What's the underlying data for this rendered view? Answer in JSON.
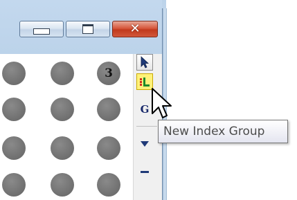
{
  "window": {
    "caption_buttons": {
      "minimize_icon": "minimize-glyph",
      "maximize_icon": "restore-glyph",
      "close_icon": "close-x-glyph",
      "close_glyph": "✕"
    },
    "colors": {
      "frame": "#bcd3ea",
      "close_button": "#c9432a",
      "dot_fill": "#6f6f6f",
      "tooltip_border": "#767676",
      "index_tool_background": "#fff27a"
    }
  },
  "grid": {
    "dots": [
      {
        "label": ""
      },
      {
        "label": ""
      },
      {
        "label": "3"
      },
      {
        "label": ""
      },
      {
        "label": ""
      },
      {
        "label": ""
      },
      {
        "label": ""
      },
      {
        "label": ""
      },
      {
        "label": ""
      },
      {
        "label": ""
      },
      {
        "label": ""
      },
      {
        "label": ""
      }
    ]
  },
  "toolbar": {
    "items": [
      {
        "icon": "select-pointer-icon"
      },
      {
        "icon": "new-index-group-icon"
      },
      {
        "icon": "g-letter-icon",
        "text": "G"
      },
      {
        "icon": "triangle-down-icon"
      },
      {
        "icon": "dash-icon"
      }
    ]
  },
  "tooltip": {
    "text": "New Index Group"
  },
  "cursor": {
    "icon": "arrow-cursor-icon"
  }
}
